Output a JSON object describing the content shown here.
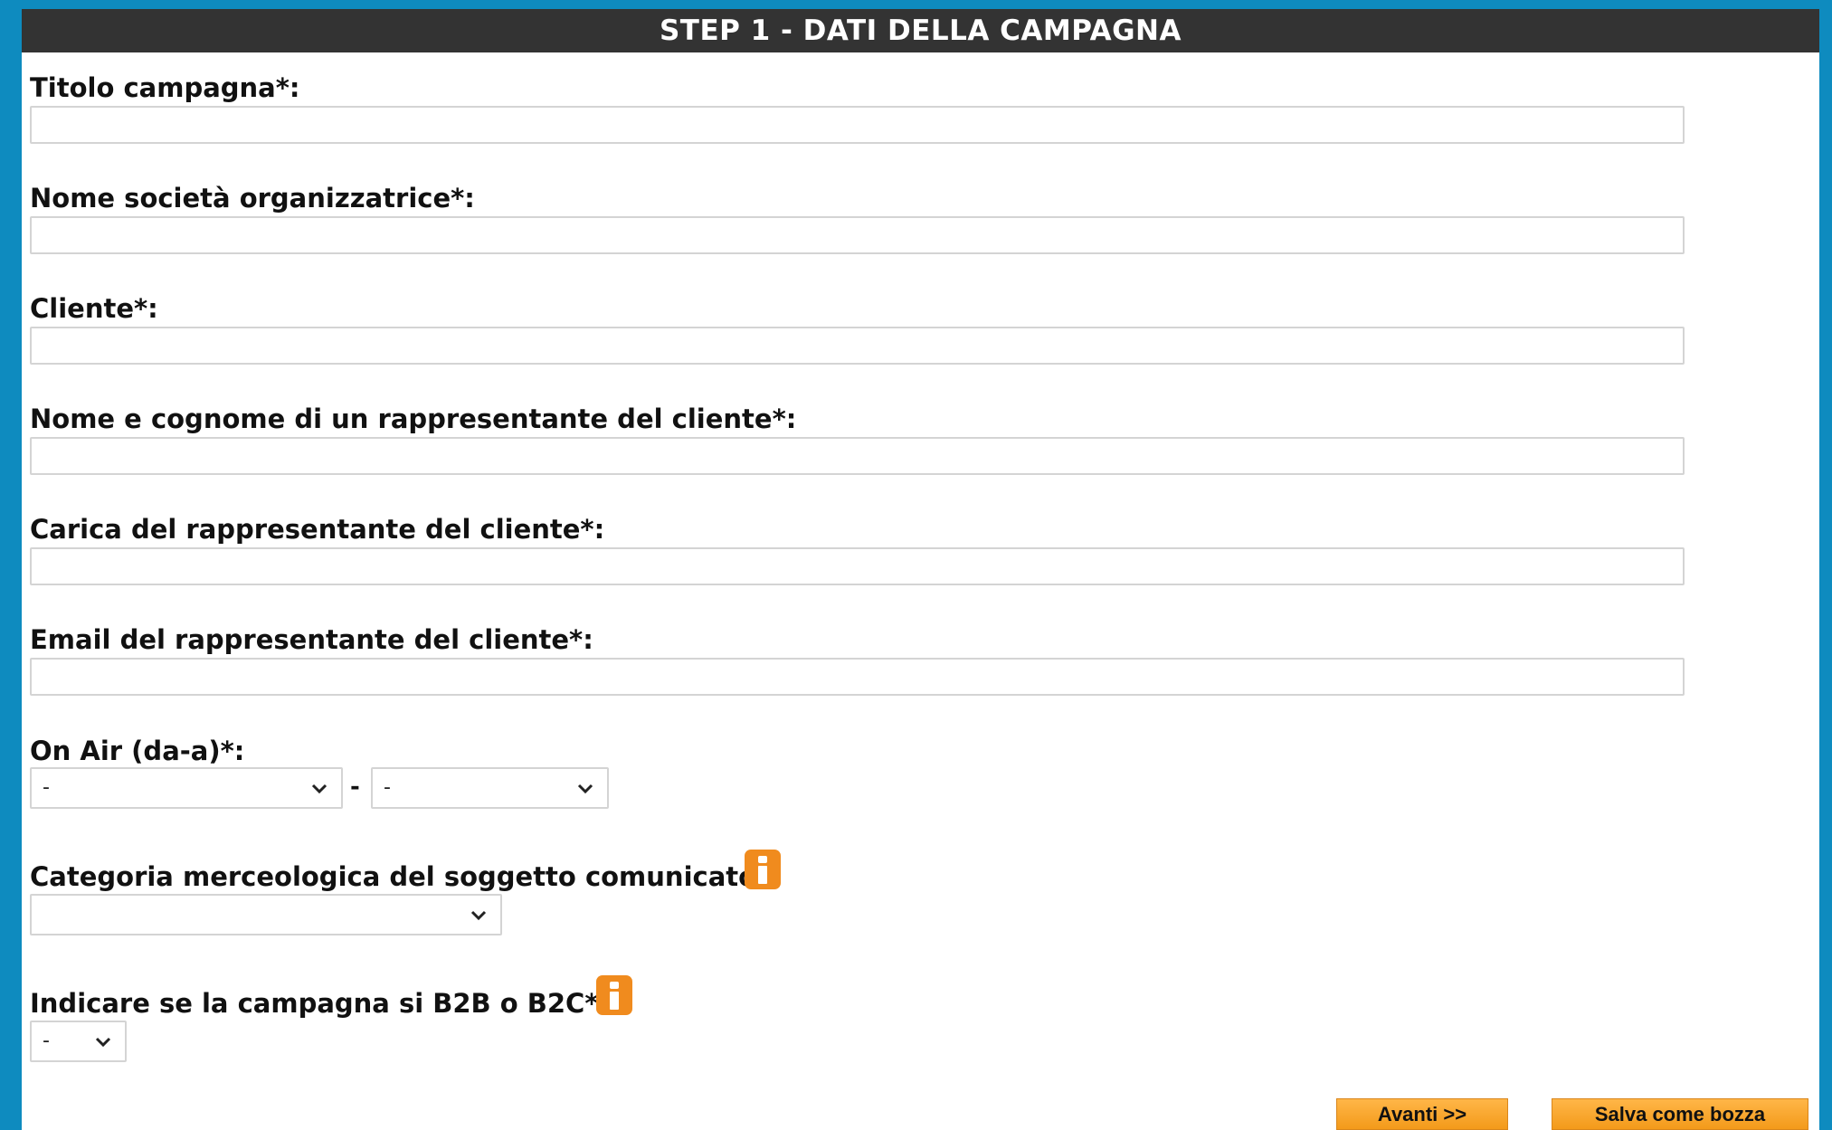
{
  "header": {
    "title": "STEP 1 - DATI DELLA CAMPAGNA"
  },
  "fields": {
    "titolo": {
      "label": "Titolo campagna*:",
      "value": ""
    },
    "societa": {
      "label": "Nome società organizzatrice*:",
      "value": ""
    },
    "cliente": {
      "label": "Cliente*:",
      "value": ""
    },
    "rappresentante": {
      "label": "Nome e cognome di un rappresentante del cliente*:",
      "value": ""
    },
    "carica": {
      "label": "Carica del rappresentante del cliente*:",
      "value": ""
    },
    "email": {
      "label": "Email del rappresentante del cliente*:",
      "value": ""
    }
  },
  "on_air": {
    "label": "On Air (da-a)*:",
    "from_selected": "-",
    "separator": "-",
    "to_selected": "-"
  },
  "categoria": {
    "label": "Categoria merceologica del soggetto comunicato*:",
    "selected": ""
  },
  "b2b_b2c": {
    "label": "Indicare se la campagna si B2B o B2C*:",
    "selected": "-"
  },
  "buttons": {
    "next": "Avanti >>",
    "save_draft": "Salva come bozza"
  },
  "colors": {
    "frame": "#0e8bbf",
    "header_bg": "#333333",
    "accent_orange": "#f08b1e"
  },
  "icons": {
    "info": "info-icon",
    "dropdown": "chevron-down-icon"
  }
}
